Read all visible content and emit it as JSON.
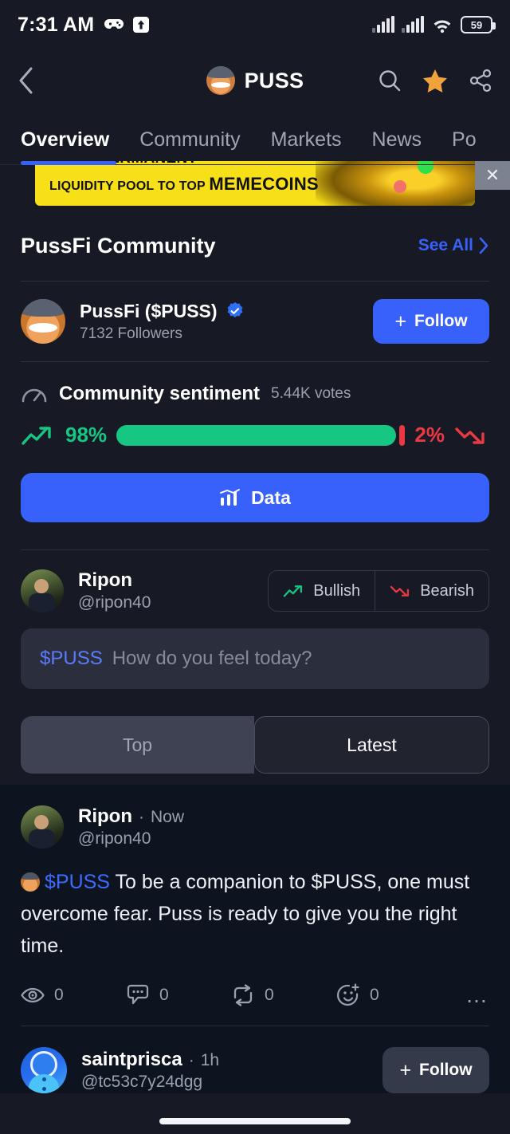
{
  "status_bar": {
    "time": "7:31 AM",
    "icons": [
      "game-controller-icon",
      "upload-arrow-icon"
    ],
    "signal_1": "signal-bars-icon",
    "signal_2": "signal-bars-icon",
    "wifi": "wifi-icon",
    "battery_level": "59"
  },
  "app_bar": {
    "back": "chevron-left-icon",
    "logo": "puss-coin-logo",
    "title": "PUSS",
    "actions": [
      "search-icon",
      "star-icon",
      "share-icon"
    ],
    "star_color": "#f0a23c"
  },
  "tabs": {
    "items": [
      {
        "label": "Overview",
        "active": true
      },
      {
        "label": "Community",
        "active": false
      },
      {
        "label": "Markets",
        "active": false
      },
      {
        "label": "News",
        "active": false
      },
      {
        "label": "Po",
        "active": false
      }
    ]
  },
  "banner": {
    "line1": "WHAT PERMANENT",
    "line2_small": "LIQUIDITY POOL TO TOP",
    "line2_big": "MEMECOINS",
    "close": "close-icon",
    "bg_color": "#f7e017"
  },
  "community": {
    "title": "PussFi Community",
    "see_all": "See All",
    "see_all_chevron": "chevron-right-icon",
    "profile": {
      "name": "PussFi ($PUSS)",
      "verified": "verified-badge-icon",
      "followers": "7132 Followers",
      "follow_label": "Follow",
      "follow_plus": "+"
    }
  },
  "sentiment": {
    "gauge_icon": "gauge-icon",
    "title": "Community sentiment",
    "votes": "5.44K votes",
    "bullish_pct": "98%",
    "bearish_pct": "2%",
    "bullish_value": 98,
    "bearish_value": 2,
    "green": "#16c784",
    "red": "#ea3943",
    "trend_up_icon": "trend-up-icon",
    "trend_down_icon": "trend-down-icon",
    "data_button": "Data",
    "data_icon": "bar-chart-icon"
  },
  "composer": {
    "avatar": "ripon-avatar",
    "name": "Ripon",
    "handle": "@ripon40",
    "bullish_label": "Bullish",
    "bearish_label": "Bearish",
    "input_ticker": "$PUSS",
    "input_placeholder": "How do you feel today?"
  },
  "feed_tabs": {
    "top": "Top",
    "latest": "Latest",
    "active": "Latest"
  },
  "feed": {
    "posts": [
      {
        "avatar": "ripon-avatar",
        "name": "Ripon",
        "separator": "·",
        "time": "Now",
        "handle": "@ripon40",
        "emoji": "cat-cowboy-emoji",
        "ticker": "$PUSS",
        "body": " To be a companion to $PUSS, one must overcome fear.  Puss is ready to give you the right time.",
        "actions": [
          {
            "icon": "eye-icon",
            "count": "0"
          },
          {
            "icon": "comment-icon",
            "count": "0"
          },
          {
            "icon": "repost-icon",
            "count": "0"
          },
          {
            "icon": "add-reaction-icon",
            "count": "0"
          }
        ],
        "more": "more-options-icon"
      },
      {
        "avatar": "saintprisca-avatar",
        "name": "saintprisca",
        "separator": "·",
        "time": "1h",
        "handle": "@tc53c7y24dgg",
        "follow_label": "Follow",
        "follow_plus": "+"
      }
    ]
  },
  "theme": {
    "top_bg": "#171a24",
    "feed_bg": "#0d1420",
    "accent_blue": "#3861fb",
    "muted_text": "#9aa0ae"
  }
}
